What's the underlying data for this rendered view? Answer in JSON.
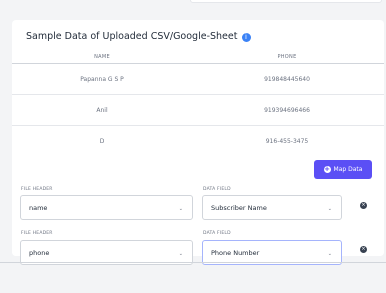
{
  "sample_card": {
    "title": "Sample Data of Uploaded CSV/Google-Sheet",
    "info_glyph": "i",
    "columns": [
      "NAME",
      "PHONE"
    ],
    "rows": [
      {
        "name": "Papanna G S P",
        "phone": "919848445640"
      },
      {
        "name": "Anil",
        "phone": "919394696466"
      },
      {
        "name": "D",
        "phone": "916-455-3475"
      }
    ]
  },
  "mapping": {
    "map_button_label": "Map Data",
    "file_header_label": "FILE HEADER",
    "data_field_label": "DATA FIELD",
    "rows": [
      {
        "file_header": "name",
        "data_field": "Subscriber Name"
      },
      {
        "file_header": "phone",
        "data_field": "Phone Number"
      }
    ],
    "chevron": "⌄",
    "remove_glyph": "×"
  },
  "icons": {
    "info": "info-icon",
    "add": "plus-circle-icon",
    "remove": "close-circle-icon"
  },
  "colors": {
    "accent": "#5b4ff5",
    "info": "#3b82f6",
    "background": "#f3f4f6"
  }
}
